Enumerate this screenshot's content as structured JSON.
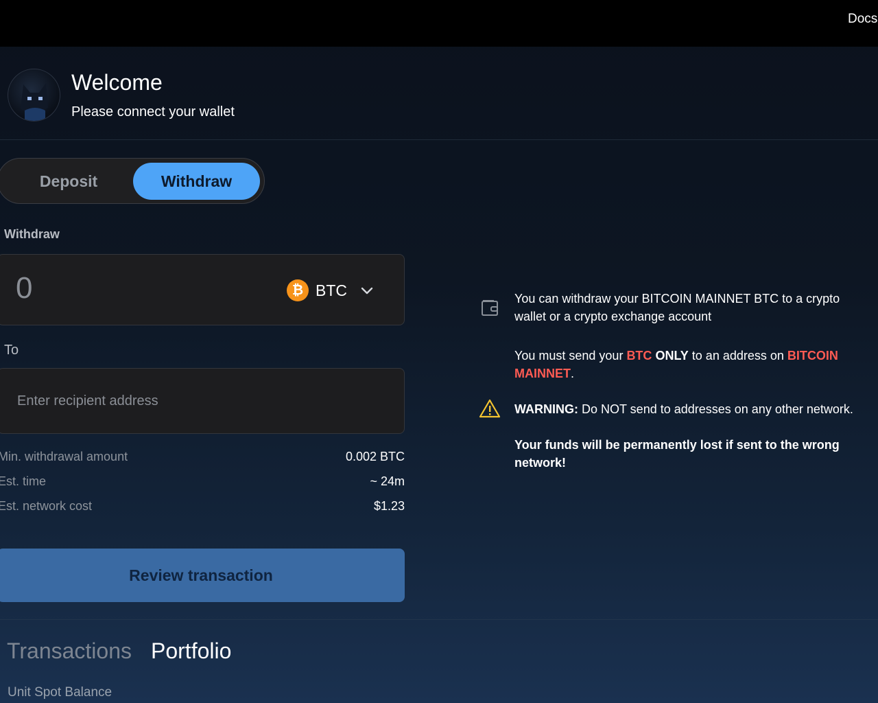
{
  "topbar": {
    "docs_label": "Docs"
  },
  "header": {
    "title": "Welcome",
    "subtitle": "Please connect your wallet"
  },
  "mode_toggle": {
    "deposit_label": "Deposit",
    "withdraw_label": "Withdraw",
    "selected": "Withdraw"
  },
  "form": {
    "withdraw_label": "Withdraw",
    "amount_value": "0",
    "token": {
      "symbol": "BTC",
      "icon_glyph": "₿",
      "icon_color": "#f7931a"
    },
    "to_label": "To",
    "address_placeholder": "Enter recipient address",
    "details": [
      {
        "label": "Min. withdrawal amount",
        "value": "0.002 BTC"
      },
      {
        "label": "Est. time",
        "value": "~ 24m"
      },
      {
        "label": "Est. network cost",
        "value": "$1.23"
      }
    ],
    "review_button": "Review transaction"
  },
  "info": {
    "line1": "You can withdraw your BITCOIN MAINNET BTC to a crypto wallet or a crypto exchange account",
    "line2": {
      "part1": "You must send your ",
      "token": "BTC",
      "only": " ONLY",
      "part2": " to an address on ",
      "network": "BITCOIN MAINNET",
      "end": "."
    },
    "warning": {
      "prefix": "WARNING:",
      "text": " Do NOT send to addresses on any other network."
    },
    "final": "Your funds will be permanently lost if sent to the wrong network!",
    "accent_color": "#ff5b53",
    "icons": {
      "first": "wallet-icon",
      "second": "warning-icon"
    }
  },
  "bottom_tabs": {
    "transactions": "Transactions",
    "portfolio": "Portfolio",
    "active": "Portfolio"
  },
  "portfolio": {
    "balance_label": "Unit Spot Balance"
  },
  "colors": {
    "primary_button": "#4ea4f7",
    "review_button": "#3a6aa3",
    "warning": "#f4c430"
  }
}
